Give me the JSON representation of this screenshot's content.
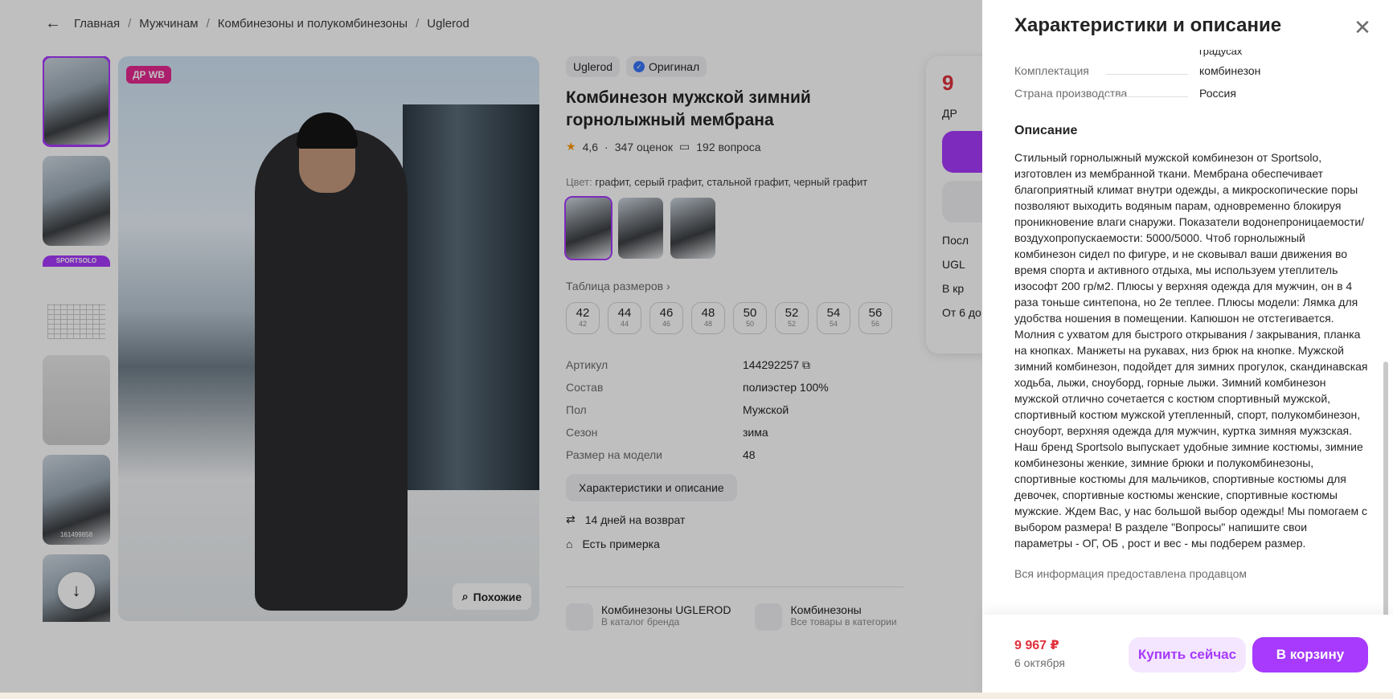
{
  "breadcrumbs": [
    "Главная",
    "Мужчинам",
    "Комбинезоны и полукомбинезоны",
    "Uglerod"
  ],
  "gallery": {
    "badge": "ДР WB",
    "similar_label": "Похожие",
    "sheet_brand": "SPORTSOLO",
    "thumb_caption": "161499858"
  },
  "product": {
    "brand": "Uglerod",
    "original_label": "Оригинал",
    "title": "Комбинезон мужской зимний горнолыжный мембрана",
    "rating": "4,6",
    "reviews": "347 оценок",
    "questions": "192 вопроса",
    "color_label": "Цвет:",
    "colors": "графит, серый графит, стальной графит, черный графит",
    "size_table_label": "Таблица размеров",
    "sizes": [
      "42",
      "44",
      "46",
      "48",
      "50",
      "52",
      "54",
      "56"
    ],
    "specs": [
      {
        "k": "Артикул",
        "v": "144292257"
      },
      {
        "k": "Состав",
        "v": "полиэстер 100%"
      },
      {
        "k": "Пол",
        "v": "Мужской"
      },
      {
        "k": "Сезон",
        "v": "зима"
      },
      {
        "k": "Размер на модели",
        "v": "48"
      }
    ],
    "char_button": "Характеристики и описание",
    "return_label": "14 дней на возврат",
    "fitting_label": "Есть примерка",
    "brand_link_title": "Комбинезоны UGLEROD",
    "brand_link_sub": "В каталог бренда",
    "cat_link_title": "Комбинезоны",
    "cat_link_sub": "Все товары в категории"
  },
  "buybox": {
    "price_partial": "9",
    "badge_partial": "ДР ",
    "line1": "Посл",
    "line2": "UGL",
    "line3": "В кр",
    "line4": "От 6 до"
  },
  "drawer": {
    "title": "Характеристики и описание",
    "cut_text": "градусах",
    "specs": [
      {
        "k": "Комплектация",
        "v": "комбинезон"
      },
      {
        "k": "Страна производства",
        "v": "Россия"
      }
    ],
    "desc_heading": "Описание",
    "description": "Стильный горнолыжный мужской комбинезон от Sportsolo, изготовлен из мембранной ткани. Мембрана обеспечивает благоприятный климат внутри одежды, а микроскопические поры позволяют выходить водяным парам, одновременно блокируя проникновение влаги снаружи. Показатели водонепроницаемости/воздухопропускаемости: 5000/5000. Чтоб горнолыжный комбинезон сидел по фигуре, и не сковывал ваши движения во время спорта и активного отдыха, мы используем утеплитель изософт 200 гр/м2. Плюсы у верхняя одежда для мужчин, он в 4 раза тоньше синтепона, но 2е теплее. Плюсы модели: Лямка для удобства ношения в помещении. Капюшон не отстегивается. Молния с ухватом для быстрого открывания / закрывания, планка на кнопках. Манжеты на рукавах, низ брюк на кнопке. Мужской зимний комбинезон, подойдет для зимних прогулок, скандинавская ходьба, лыжи, сноуборд, горные лыжи. Зимний комбинезон мужской отлично сочетается с костюм спортивный мужской, спортивный костюм мужской утепленный, спорт, полукомбинезон, сноуборт, верхняя одежда для мужчин, куртка зимняя мужзская. Наш бренд Sportsolo выпускает удобные зимние костюмы, зимние комбинезоны женкие, зимние брюки и полукомбинезоны, спортивные костюмы для мальчиков, спортивные костюмы для девочек, спортивные костюмы женские, спортивные костюмы мужские. Ждем Вас, у нас большой выбор одежды! Мы помогаем с выбором размера! В разделе \"Вопросы\" напишите свои параметры - ОГ, ОБ , рост и вес - мы подберем размер.",
    "seller_note": "Вся информация предоставлена продавцом"
  },
  "footer": {
    "price": "9 967 ₽",
    "date": "6 октября",
    "buy_now": "Купить сейчас",
    "to_cart": "В корзину"
  },
  "colors": {
    "accent": "#a73afd",
    "price": "#e0303c",
    "badge": "#e62990"
  },
  "icons": [
    "back-arrow-icon",
    "verified-check-icon",
    "star-icon",
    "question-icon",
    "copy-icon",
    "return-icon",
    "hanger-icon",
    "close-icon",
    "down-arrow-icon",
    "search-image-icon",
    "tag-icon",
    "layers-icon"
  ]
}
